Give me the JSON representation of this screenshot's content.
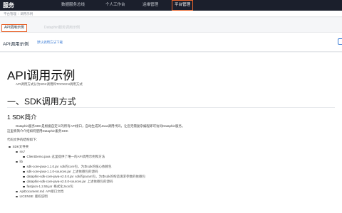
{
  "topnav": {
    "brand": "服务",
    "items": [
      "数据服务总线",
      "个人工作台",
      "运维管理",
      "平台管理"
    ],
    "active_item": "平台管理"
  },
  "breadcrumb": [
    "平台管理",
    "调用示例"
  ],
  "tabs": [
    {
      "label": "API调用示例",
      "active": true
    },
    {
      "label": "Dataphin服务调用示例",
      "active": false
    }
  ],
  "subheader": {
    "title": "API调用示例",
    "link": "默认调用方法下载"
  },
  "doc": {
    "title": "API调用示例",
    "subtitle": "API调用方式分为SDK调用和TOOKEN调用方式",
    "section_heading": "一、SDK调用方式",
    "subsection_heading": "1 SDK简介",
    "intro_line1": "Dataphin服务SDK是根据自定义的所有API接口，自动生成的Java调用代码，让您无需复杂编程即可访问Dataphin服务。",
    "intro_line2": "这里将简介介绍如何使用Dataphin服务SDK",
    "structure_label": "代码文件的结构如下：",
    "tree": [
      {
        "level": 0,
        "name": "SDK文件夹",
        "desc": ""
      },
      {
        "level": 1,
        "name": "src/",
        "desc": ""
      },
      {
        "level": 2,
        "name": "ClientDemo.java",
        "desc": "这里提供了唯一的API调用示例和方法"
      },
      {
        "level": 1,
        "name": "lib",
        "desc": ""
      },
      {
        "level": 2,
        "name": "sdk-core-java-1.1.0.jar",
        "desc": "sdk的core包，为本sdk的核心依赖包"
      },
      {
        "level": 2,
        "name": "sdk-core-java-1.1.0-sources.jar",
        "desc": "上述依赖包的源码"
      },
      {
        "level": 2,
        "name": "dataphin-sdk-core-java-v2.0.0.jar",
        "desc": "sdk的param包，为本sdk的构造请求参数的依赖包"
      },
      {
        "level": 2,
        "name": "dataphin-sdk-core-java-v2.0.0-sources.jar",
        "desc": "上述依赖包的源码"
      },
      {
        "level": 2,
        "name": "fastjson-1.2.55.jar",
        "desc": "格式化Json包"
      },
      {
        "level": 1,
        "name": "ApiDocument.md",
        "desc": "API接口文档"
      },
      {
        "level": 1,
        "name": "LICENSE",
        "desc": "版权说明"
      }
    ]
  },
  "colors": {
    "nav_bg": "#1b1f2c",
    "accent": "#e8642c",
    "link": "#3a7bd5"
  }
}
